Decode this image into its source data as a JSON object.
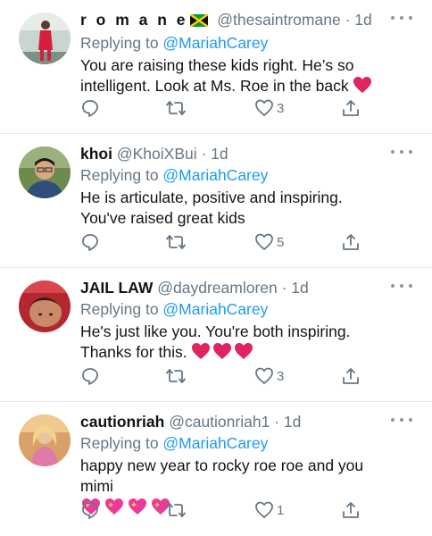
{
  "tweets": [
    {
      "name": "r o m a n e",
      "flag_icon": "jamaica-flag-icon",
      "handle": "@thesaintromane",
      "time": "· 1d",
      "replying_prefix": "Replying to ",
      "replying_to": "@MariahCarey",
      "text": "You are raising these kids right. He’s so intelligent. Look at Ms. Roe in the back",
      "emoji": [
        "red-heart-icon"
      ],
      "likes": "3",
      "avatar_colors": {
        "bg": "#c9d6cf",
        "figure": "#d61f3c"
      }
    },
    {
      "name": "khoi",
      "handle": "@KhoiXBui",
      "time": "· 1d",
      "replying_prefix": "Replying to ",
      "replying_to": "@MariahCarey",
      "text": "He is articulate, positive and inspiring. You've raised great kids",
      "emoji": [],
      "likes": "5",
      "avatar_colors": {
        "bg": "#6f8a4e",
        "figure": "#2f4f7a"
      }
    },
    {
      "name": "JAIL LAW",
      "handle": "@daydreamloren",
      "time": "· 1d",
      "replying_prefix": "Replying to ",
      "replying_to": "@MariahCarey",
      "text": "He's just like you. You're both inspiring. Thanks for this.",
      "emoji": [
        "red-heart-icon",
        "red-heart-icon",
        "red-heart-icon"
      ],
      "likes": "3",
      "avatar_colors": {
        "bg": "#b3272e",
        "figure": "#3a1a18"
      }
    },
    {
      "name": "cautionriah",
      "handle": "@cautionriah1",
      "time": "· 1d",
      "replying_prefix": "Replying to ",
      "replying_to": "@MariahCarey",
      "text": "happy new year to rocky roe roe and you mimi",
      "emoji": [
        "sparkling-heart-icon",
        "sparkling-heart-icon",
        "sparkling-heart-icon",
        "sparkling-heart-icon"
      ],
      "likes": "1",
      "avatar_colors": {
        "bg": "#d9a06a",
        "figure": "#e07aa8"
      }
    }
  ],
  "colors": {
    "mention": "#1d9bf0",
    "muted": "#657786",
    "heart_red": "#e0245e",
    "heart_pink": "#ec3a9a"
  }
}
